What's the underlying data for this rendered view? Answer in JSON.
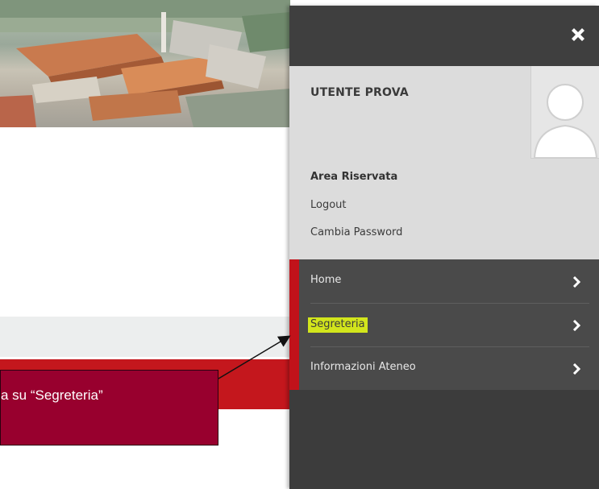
{
  "panel": {
    "close_icon": "close-icon",
    "user_name": "UTENTE PROVA",
    "avatar_icon": "user-avatar-icon",
    "area_title": "Area Riservata",
    "links": [
      "Logout",
      "Cambia Password"
    ],
    "menu": [
      {
        "label": "Home",
        "icon": "chevron-right-icon"
      },
      {
        "label": "Segreteria",
        "icon": "chevron-right-icon",
        "highlighted": true
      },
      {
        "label": "Informazioni Ateneo",
        "icon": "chevron-right-icon"
      }
    ]
  },
  "callout": {
    "text": "a su “Segreteria”"
  },
  "colors": {
    "accent_red": "#c4171d",
    "callout_bg": "#98002e",
    "panel_bg": "#3c3c3c",
    "user_box_bg": "#dcdcdc",
    "highlight": "#d2e51c"
  }
}
